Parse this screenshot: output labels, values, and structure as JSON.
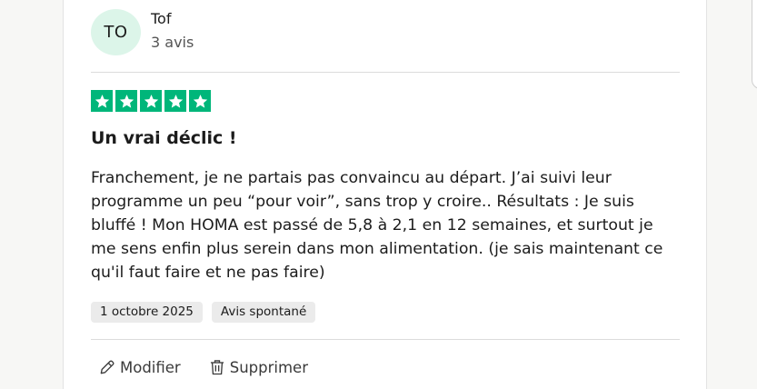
{
  "review": {
    "author": {
      "initials": "TO",
      "name": "Tof",
      "review_count": "3 avis"
    },
    "rating": 5,
    "title": "Un vrai déclic !",
    "body": "Franchement, je ne partais pas convaincu au départ. J’ai suivi leur programme un peu “pour voir”, sans trop y croire.. Résultats : Je suis bluffé ! Mon HOMA est passé de 5,8 à 2,1 en 12 semaines, et surtout je me sens enfin plus serein dans mon alimentation. (je sais maintenant ce qu'il faut faire et ne pas faire)",
    "date": "1 octobre 2025",
    "tag": "Avis spontané",
    "actions": {
      "edit": "Modifier",
      "delete": "Supprimer"
    }
  },
  "colors": {
    "star_green": "#00b67a",
    "avatar_bg": "#dcf5e9",
    "tag_bg": "#ebebeb"
  }
}
